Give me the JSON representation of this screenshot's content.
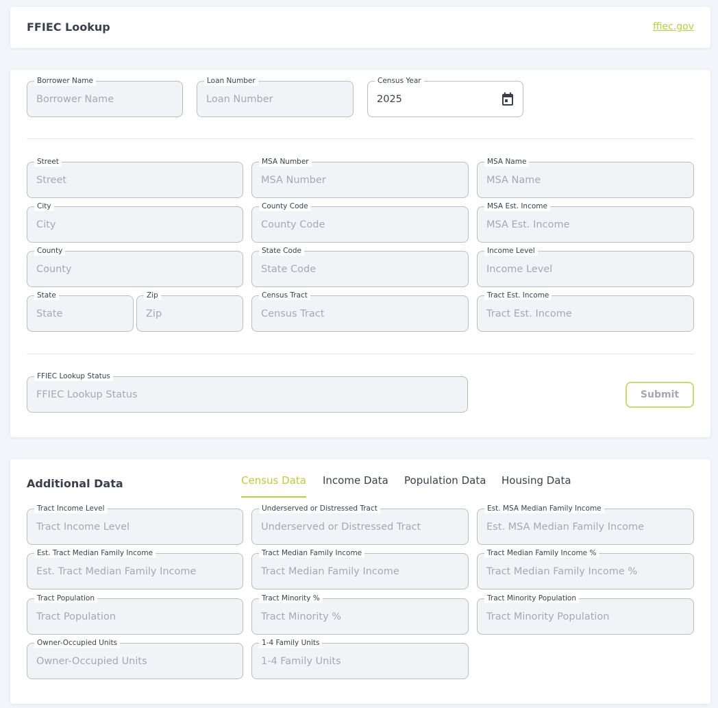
{
  "header": {
    "title": "FFIEC Lookup",
    "link": "ffiec.gov"
  },
  "form": {
    "borrower_name": {
      "label": "Borrower Name",
      "placeholder": "Borrower Name"
    },
    "loan_number": {
      "label": "Loan Number",
      "placeholder": "Loan Number"
    },
    "census_year": {
      "label": "Census Year",
      "value": "2025"
    },
    "street": {
      "label": "Street",
      "placeholder": "Street"
    },
    "msa_number": {
      "label": "MSA Number",
      "placeholder": "MSA Number"
    },
    "msa_name": {
      "label": "MSA Name",
      "placeholder": "MSA Name"
    },
    "city": {
      "label": "City",
      "placeholder": "City"
    },
    "county_code": {
      "label": "County Code",
      "placeholder": "County Code"
    },
    "msa_est_income": {
      "label": "MSA Est. Income",
      "placeholder": "MSA Est. Income"
    },
    "county": {
      "label": "County",
      "placeholder": "County"
    },
    "state_code": {
      "label": "State Code",
      "placeholder": "State Code"
    },
    "income_level": {
      "label": "Income Level",
      "placeholder": "Income Level"
    },
    "state": {
      "label": "State",
      "placeholder": "State"
    },
    "zip": {
      "label": "Zip",
      "placeholder": "Zip"
    },
    "census_tract": {
      "label": "Census Tract",
      "placeholder": "Census Tract"
    },
    "tract_est_income": {
      "label": "Tract Est. Income",
      "placeholder": "Tract Est. Income"
    },
    "lookup_status": {
      "label": "FFIEC Lookup Status",
      "placeholder": "FFIEC Lookup Status"
    },
    "submit_label": "Submit"
  },
  "additional": {
    "title": "Additional Data",
    "tabs": [
      "Census Data",
      "Income Data",
      "Population Data",
      "Housing Data"
    ],
    "active_tab": "Census Data",
    "fields": {
      "tract_income_level": {
        "label": "Tract Income Level",
        "placeholder": "Tract Income Level"
      },
      "underserved": {
        "label": "Underserved or Distressed Tract",
        "placeholder": "Underserved or Distressed Tract"
      },
      "est_msa_mfi": {
        "label": "Est. MSA Median Family Income",
        "placeholder": "Est. MSA Median Family Income"
      },
      "est_tract_mfi": {
        "label": "Est. Tract Median Family Income",
        "placeholder": "Est. Tract Median Family Income"
      },
      "tract_mfi": {
        "label": "Tract Median Family Income",
        "placeholder": "Tract Median Family Income"
      },
      "tract_mfi_pct": {
        "label": "Tract Median Family Income %",
        "placeholder": "Tract Median Family Income %"
      },
      "tract_population": {
        "label": "Tract Population",
        "placeholder": "Tract Population"
      },
      "tract_minority_pct": {
        "label": "Tract Minority %",
        "placeholder": "Tract Minority %"
      },
      "tract_minority_population": {
        "label": "Tract Minority Population",
        "placeholder": "Tract Minority Population"
      },
      "owner_occupied_units": {
        "label": "Owner-Occupied Units",
        "placeholder": "Owner-Occupied Units"
      },
      "family_units_1_4": {
        "label": "1-4 Family Units",
        "placeholder": "1-4 Family Units"
      }
    }
  },
  "colors": {
    "accent": "#b5d334",
    "field_bg": "#f2f3f6",
    "page_bg": "#f3f5fb"
  },
  "icons": {
    "census_year": "calendar-icon"
  }
}
